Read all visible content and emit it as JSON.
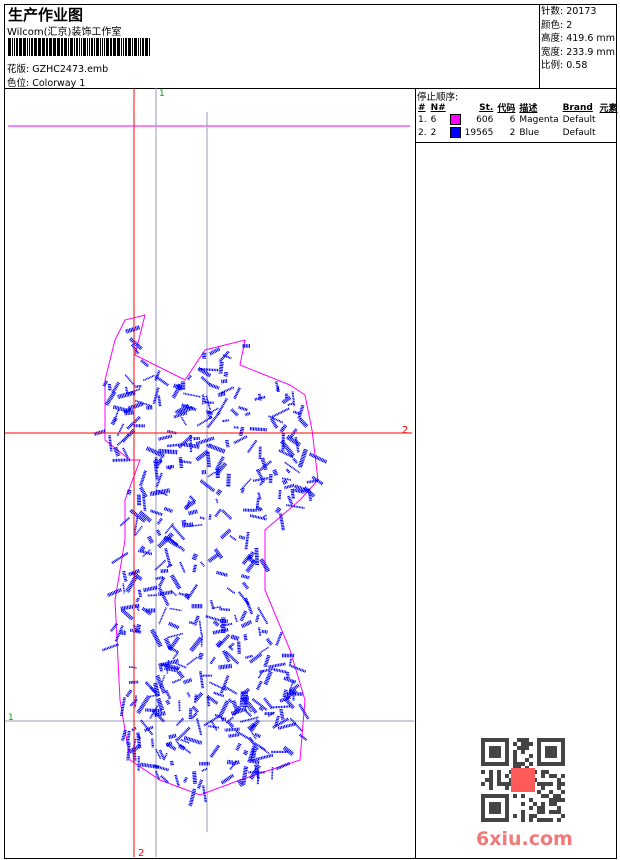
{
  "header": {
    "title": "生产作业图",
    "company": "Wilcom(汇京)装饰工作室",
    "design_label": "花版:",
    "design_value": "GZHC2473.emb",
    "colorway_label": "色位:",
    "colorway_value": "Colorway 1"
  },
  "info": {
    "stitches": "针数: 20173",
    "colors": "颜色: 2",
    "height": "高度: 419.6 mm",
    "width": "宽度: 233.9 mm",
    "scale": "比例: 0.58"
  },
  "color_table": {
    "title": "停止顺序:",
    "headers": [
      "#",
      "N#",
      "",
      "St.",
      "代码",
      "描述",
      "Brand",
      "元素"
    ],
    "rows": [
      {
        "idx": "1.",
        "n": "6",
        "color": "#ff00ff",
        "st": "606",
        "code": "6",
        "desc": "Magenta",
        "brand": "Default"
      },
      {
        "idx": "2.",
        "n": "2",
        "color": "#0000ff",
        "st": "19565",
        "code": "2",
        "desc": "Blue",
        "brand": "Default"
      }
    ]
  },
  "guides": {
    "label_1_top": "1",
    "label_1_left": "1",
    "label_2_right": "2",
    "label_2_bottom": "2"
  },
  "watermark": "6xiu.com",
  "colors": {
    "outline": "#ff00ff",
    "fill": "#0000ff",
    "guide_red": "#ff0000",
    "guide_green": "#00aa00"
  }
}
